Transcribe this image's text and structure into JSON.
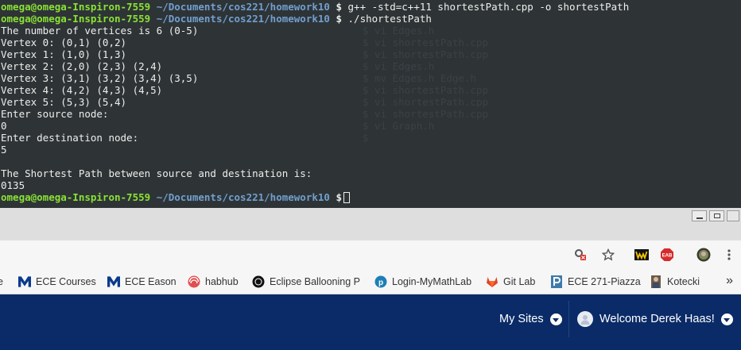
{
  "terminal": {
    "prompt_user": "omega@omega-Inspiron-7559",
    "prompt_path": "~/Documents/cos221/homework10",
    "prompt_symbol": "$",
    "command": "g++ -std=c++11 shortestPath.cpp -o shortestPath",
    "run_command": "./shortestPath",
    "output": [
      "The number of vertices is 6 (0-5)",
      "Vertex 0: (0,1) (0,2)",
      "Vertex 1: (1,0) (1,3)",
      "Vertex 2: (2,0) (2,3) (2,4)",
      "Vertex 3: (3,1) (3,2) (3,4) (3,5)",
      "Vertex 4: (4,2) (4,3) (4,5)",
      "Vertex 5: (5,3) (5,4)",
      "Enter source node:",
      "0",
      "Enter destination node:",
      "5",
      "",
      "The Shortest Path between source and destination is:",
      "0135"
    ],
    "ghost_lines": [
      "$ vi Edges.h",
      "$ vi shortestPath.cpp",
      "$ vi shortestPath.cpp",
      "$ vi Edges.h",
      "$ mv Edges.h Edge.h",
      "$ vi shortestPath.cpp",
      "$ vi shortestPath.cpp",
      "$ vi shortestPath.cpp",
      "$ vi Graph.h",
      "$"
    ]
  },
  "browser": {
    "toolbar_icons": [
      "key-blocked-icon",
      "star-icon",
      "extension-w-icon",
      "extension-eab-icon",
      "extension-monkey-icon",
      "menu-icon"
    ],
    "eab_badge": "EAB",
    "bookmarks": [
      {
        "label": "e",
        "icon": "truncated"
      },
      {
        "label": "ECE Courses",
        "icon": "umaine-m-icon"
      },
      {
        "label": "ECE Eason",
        "icon": "umaine-m-icon"
      },
      {
        "label": "habhub",
        "icon": "habhub-icon"
      },
      {
        "label": "Eclipse Ballooning P",
        "icon": "eclipse-icon"
      },
      {
        "label": "Login-MyMathLab",
        "icon": "pearson-icon"
      },
      {
        "label": "Git Lab",
        "icon": "gitlab-icon"
      },
      {
        "label": "ECE 271-Piazza",
        "icon": "piazza-icon"
      },
      {
        "label": "Kotecki",
        "icon": "kotecki-icon"
      }
    ],
    "bookmarks_more": "»",
    "site": {
      "my_sites": "My Sites",
      "welcome": "Welcome Derek Haas!"
    },
    "colors": {
      "site_bar": "#0a2b67",
      "prompt_green": "#8ae234",
      "prompt_blue": "#729fcf"
    }
  }
}
